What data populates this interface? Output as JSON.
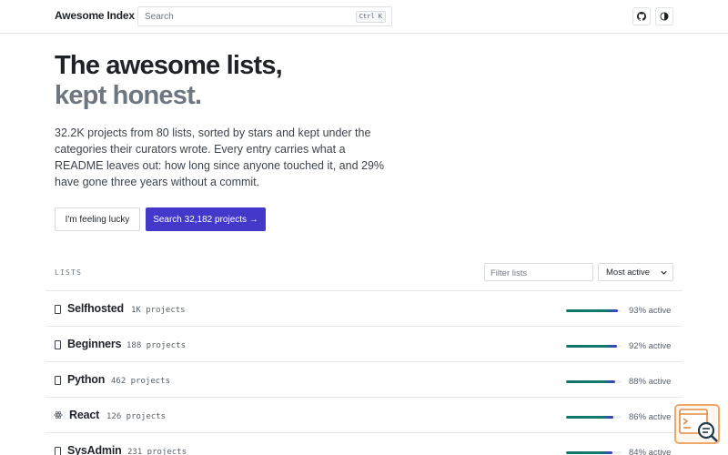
{
  "header": {
    "brand": "Awesome Index",
    "search_placeholder": "Search",
    "search_shortcut": "Ctrl K",
    "github_icon": "github-icon",
    "theme_icon": "contrast-icon"
  },
  "hero": {
    "title": "The awesome lists,",
    "subtitle": "kept honest.",
    "description": "32.2K projects from 80 lists, sorted by stars and kept under the categories their curators wrote. Every entry carries what a README leaves out: how long since anyone touched it, and 29% have gone three years without a commit.",
    "lucky_button": "I'm feeling lucky",
    "search_button": "Search 32,182 projects →"
  },
  "lists": {
    "label": "LISTS",
    "filter_placeholder": "Filter lists",
    "sort_value": "Most active",
    "items": [
      {
        "name": "Selfhosted",
        "count": "1K projects",
        "active_fraction": 0.93,
        "active_label": "93% active",
        "icon": "book-icon"
      },
      {
        "name": "Beginners",
        "count": "188 projects",
        "active_fraction": 0.92,
        "active_label": "92% active",
        "icon": "book-icon"
      },
      {
        "name": "Python",
        "count": "462 projects",
        "active_fraction": 0.88,
        "active_label": "88% active",
        "icon": "book-icon"
      },
      {
        "name": "React",
        "count": "126 projects",
        "active_fraction": 0.86,
        "active_label": "86% active",
        "icon": "atom-icon"
      },
      {
        "name": "SysAdmin",
        "count": "231 projects",
        "active_fraction": 0.84,
        "active_label": "84% active",
        "icon": "book-icon"
      }
    ]
  },
  "colors": {
    "accent": "#4338ca",
    "bar_start": "#0f766e",
    "muted_text": "#6e7781"
  },
  "widget_icon": "terminal-search-icon"
}
